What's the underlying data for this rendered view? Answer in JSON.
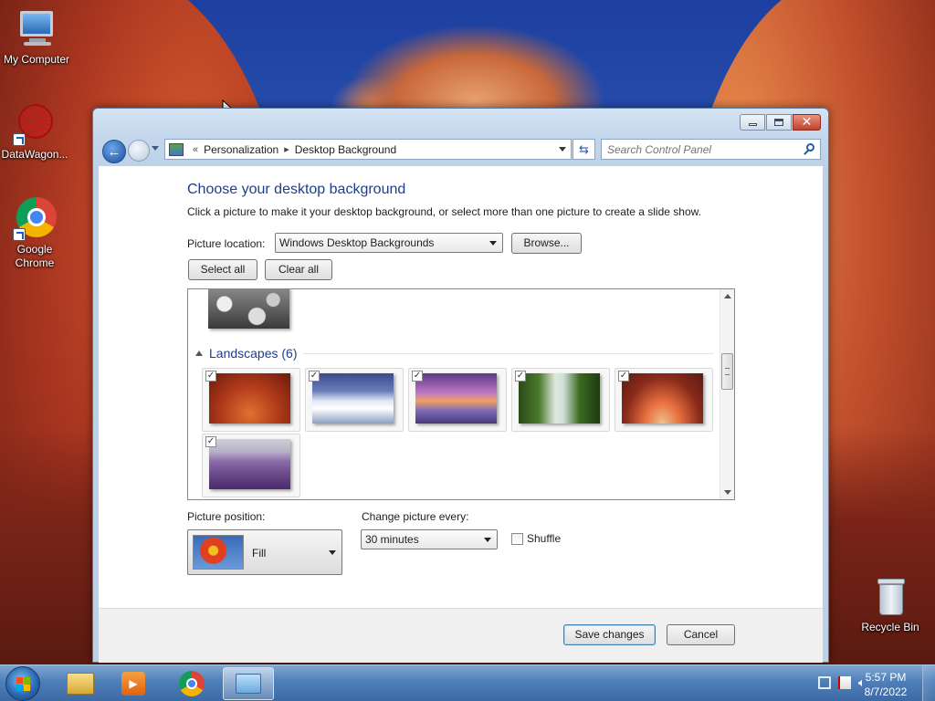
{
  "desktop": {
    "icons": [
      {
        "label": "My Computer"
      },
      {
        "label": "DataWagon..."
      },
      {
        "label": "Google Chrome"
      },
      {
        "label": "Recycle Bin"
      }
    ]
  },
  "window": {
    "address": {
      "overflow": "«",
      "crumbs": [
        "Personalization",
        "Desktop Background"
      ]
    },
    "search_placeholder": "Search Control Panel",
    "title": "Choose your desktop background",
    "description": "Click a picture to make it your desktop background, or select more than one picture to create a slide show.",
    "picture_location_label": "Picture location:",
    "picture_location_value": "Windows Desktop Backgrounds",
    "browse_label": "Browse...",
    "select_all_label": "Select all",
    "clear_all_label": "Clear all",
    "group_title": "Landscapes (6)",
    "pictures": [
      {
        "checked": true
      },
      {
        "checked": true
      },
      {
        "checked": true
      },
      {
        "checked": true
      },
      {
        "checked": true
      },
      {
        "checked": true
      }
    ],
    "picture_position_label": "Picture position:",
    "picture_position_value": "Fill",
    "change_every_label": "Change picture every:",
    "change_every_value": "30 minutes",
    "shuffle_label": "Shuffle",
    "shuffle_checked": false,
    "save_label": "Save changes",
    "cancel_label": "Cancel"
  },
  "taskbar": {
    "time": "5:57 PM",
    "date": "8/7/2022"
  },
  "colors": {
    "accent_heading": "#1e3e8c",
    "taskbar": "#4f7fb8"
  }
}
